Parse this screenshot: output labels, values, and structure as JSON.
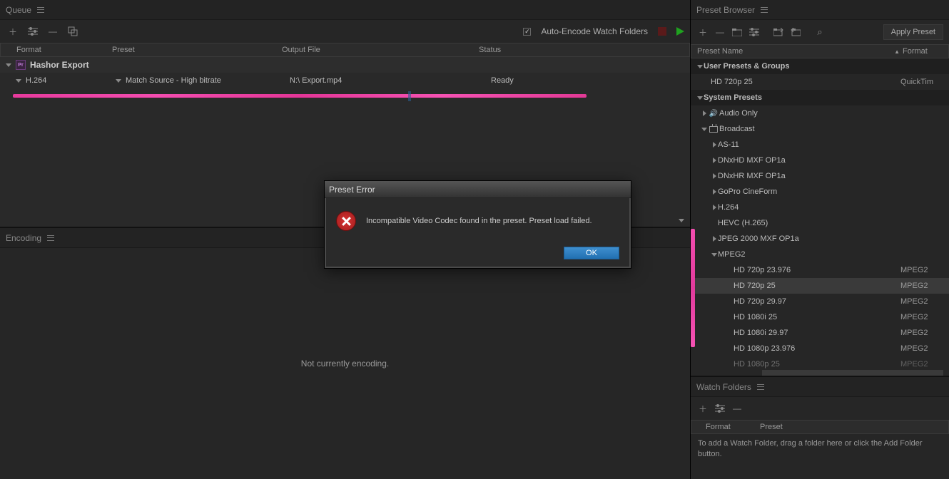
{
  "queue": {
    "title": "Queue",
    "toolbar": {
      "auto_encode_label": "Auto-Encode Watch Folders",
      "auto_encode_checked": "✓"
    },
    "columns": {
      "format": "Format",
      "preset": "Preset",
      "output": "Output File",
      "status": "Status"
    },
    "group_name": "Hashor Export",
    "row": {
      "format": "H.264",
      "preset": "Match Source - High bitrate",
      "output": "N:\\  Export.mp4",
      "status": "Ready"
    }
  },
  "encoding": {
    "title": "Encoding",
    "body": "Not currently encoding."
  },
  "preset_browser": {
    "title": "Preset Browser",
    "apply_label": "Apply Preset",
    "col_name": "Preset Name",
    "col_format": "Format",
    "user_presets": "User Presets & Groups",
    "user_item": {
      "name": "HD 720p 25",
      "fmt": "QuickTim"
    },
    "system_presets": "System Presets",
    "audio_only": "Audio Only",
    "broadcast": "Broadcast",
    "broadcast_children": [
      "AS-11",
      "DNxHD MXF OP1a",
      "DNxHR MXF OP1a",
      "GoPro CineForm",
      "H.264",
      "HEVC (H.265)",
      "JPEG 2000 MXF OP1a"
    ],
    "mpeg2": "MPEG2",
    "mpeg2_items": [
      {
        "name": "HD 720p 23.976",
        "fmt": "MPEG2"
      },
      {
        "name": "HD 720p 25",
        "fmt": "MPEG2"
      },
      {
        "name": "HD 720p 29.97",
        "fmt": "MPEG2"
      },
      {
        "name": "HD 1080i 25",
        "fmt": "MPEG2"
      },
      {
        "name": "HD 1080i 29.97",
        "fmt": "MPEG2"
      },
      {
        "name": "HD 1080p 23.976",
        "fmt": "MPEG2"
      },
      {
        "name": "HD 1080p 25",
        "fmt": "MPEG2"
      }
    ]
  },
  "watch": {
    "title": "Watch Folders",
    "col_format": "Format",
    "col_preset": "Preset",
    "hint": "To add a Watch Folder, drag a folder here or click the Add Folder button."
  },
  "modal": {
    "title": "Preset Error",
    "message": "Incompatible Video Codec found in the preset. Preset load failed.",
    "ok": "OK"
  }
}
